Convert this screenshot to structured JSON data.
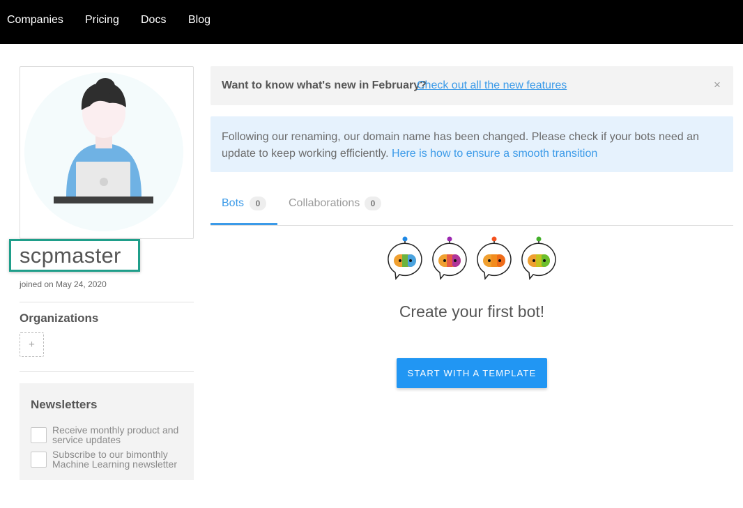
{
  "nav": {
    "links": [
      "Companies",
      "Pricing",
      "Docs",
      "Blog"
    ]
  },
  "profile": {
    "username": "scpmaster",
    "joined": "joined on May 24, 2020",
    "organizations_title": "Organizations",
    "add_org_symbol": "+",
    "avatar_icon": "user-laptop-icon"
  },
  "newsletters": {
    "title": "Newsletters",
    "items": [
      "Receive monthly product and service updates",
      "Subscribe to our bimonthly Machine Learning newsletter"
    ]
  },
  "announcement": {
    "bold": "Want to know what's new in February?",
    "link": "Check out all the new features",
    "close_symbol": "×"
  },
  "info_banner": {
    "text": "Following our renaming, our domain name has been changed. Please check if your bots need an update to keep working efficiently.",
    "link": "Here is how to ensure a smooth transition"
  },
  "tabs": [
    {
      "label": "Bots",
      "count": "0",
      "active": true
    },
    {
      "label": "Collaborations",
      "count": "0",
      "active": false
    }
  ],
  "empty_state": {
    "title": "Create your first bot!",
    "button": "START WITH A TEMPLATE",
    "illustration_icon": "bot-faces-icon"
  },
  "colors": {
    "accent": "#3b9ae8",
    "button": "#2196f3",
    "highlight_border": "#1f9e8a",
    "nav_bg": "#000000"
  }
}
